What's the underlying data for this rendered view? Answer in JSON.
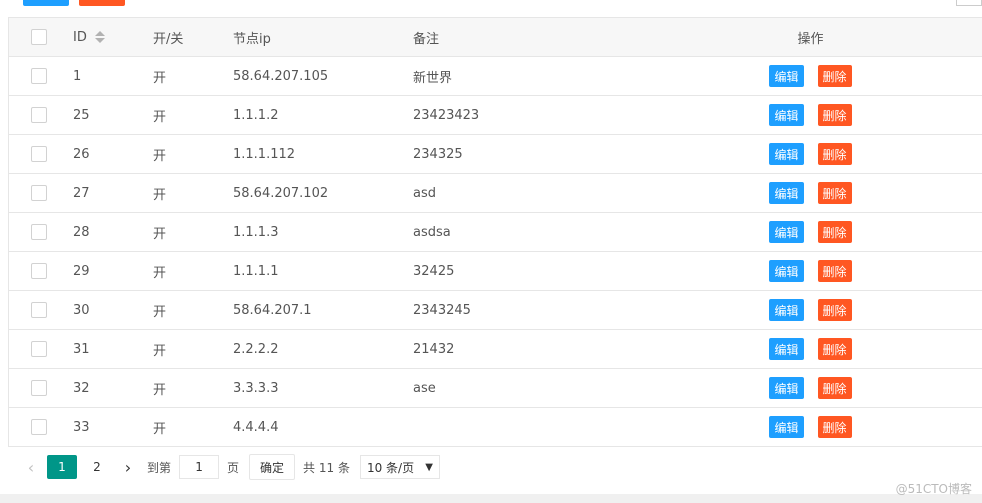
{
  "header": {
    "id": "ID",
    "switch": "开/关",
    "ip": "节点ip",
    "note": "备注",
    "ops": "操作"
  },
  "rows": [
    {
      "id": "1",
      "switch": "开",
      "ip": "58.64.207.105",
      "note": "新世界"
    },
    {
      "id": "25",
      "switch": "开",
      "ip": "1.1.1.2",
      "note": "23423423"
    },
    {
      "id": "26",
      "switch": "开",
      "ip": "1.1.1.112",
      "note": "234325"
    },
    {
      "id": "27",
      "switch": "开",
      "ip": "58.64.207.102",
      "note": "asd"
    },
    {
      "id": "28",
      "switch": "开",
      "ip": "1.1.1.3",
      "note": "asdsa"
    },
    {
      "id": "29",
      "switch": "开",
      "ip": "1.1.1.1",
      "note": "32425"
    },
    {
      "id": "30",
      "switch": "开",
      "ip": "58.64.207.1",
      "note": "2343245"
    },
    {
      "id": "31",
      "switch": "开",
      "ip": "2.2.2.2",
      "note": "21432"
    },
    {
      "id": "32",
      "switch": "开",
      "ip": "3.3.3.3",
      "note": "ase"
    },
    {
      "id": "33",
      "switch": "开",
      "ip": "4.4.4.4",
      "note": ""
    }
  ],
  "actions": {
    "edit": "编辑",
    "delete": "删除"
  },
  "pager": {
    "pages": [
      "1",
      "2"
    ],
    "goto_label": "到第",
    "goto_value": "1",
    "page_suffix": "页",
    "confirm": "确定",
    "total": "共 11 条",
    "per_page": "10 条/页",
    "prev_icon": "‹",
    "next_icon": "›"
  },
  "watermark": "@51CTO博客",
  "colors": {
    "edit_blue": "#1e9fff",
    "delete_orange": "#ff5722",
    "active_page": "#009688"
  }
}
